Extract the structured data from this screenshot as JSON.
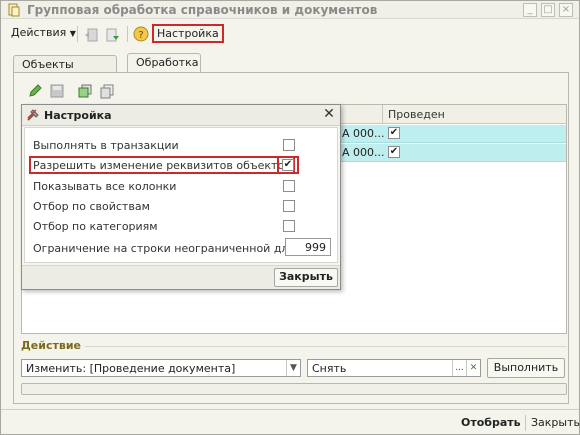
{
  "window": {
    "title": "Групповая обработка справочников и документов",
    "min_label": "_",
    "max_label": "□",
    "close_label": "×"
  },
  "toolbar": {
    "actions_label": "Действия",
    "help_label": "?",
    "settings_label": "Настройка"
  },
  "tabs": [
    {
      "label": "Объекты отбора",
      "active": false
    },
    {
      "label": "Обработка",
      "active": true
    }
  ],
  "grid": {
    "column_posted": "Проведен",
    "rows": [
      {
        "text": "А 000...",
        "posted": true
      },
      {
        "text": "А 000...",
        "posted": true
      }
    ],
    "row_color": "#bfeeee"
  },
  "dialog": {
    "title": "Настройка",
    "close_label": "✕",
    "options": [
      {
        "label": "Выполнять в транзакции",
        "checked": false
      },
      {
        "label": "Разрешить изменение реквизитов объектов",
        "checked": true
      },
      {
        "label": "Показывать все колонки",
        "checked": false
      },
      {
        "label": "Отбор по свойствам",
        "checked": false
      },
      {
        "label": "Отбор по категориям",
        "checked": false
      }
    ],
    "limit_label": "Ограничение на строки неограниченной длины:",
    "limit_value": "999",
    "close_button": "Закрыть"
  },
  "action_section": {
    "title": "Действие",
    "action_value": "Изменить: [Проведение документа]",
    "param_value": "Снять",
    "ellipsis_label": "...",
    "clear_label": "✕",
    "execute_label": "Выполнить"
  },
  "bottom": {
    "select_label": "Отобрать",
    "close_label": "Закрыть"
  },
  "colors": {
    "highlight_red": "#cc2a2a",
    "accent_gold": "#7a6a1a"
  }
}
